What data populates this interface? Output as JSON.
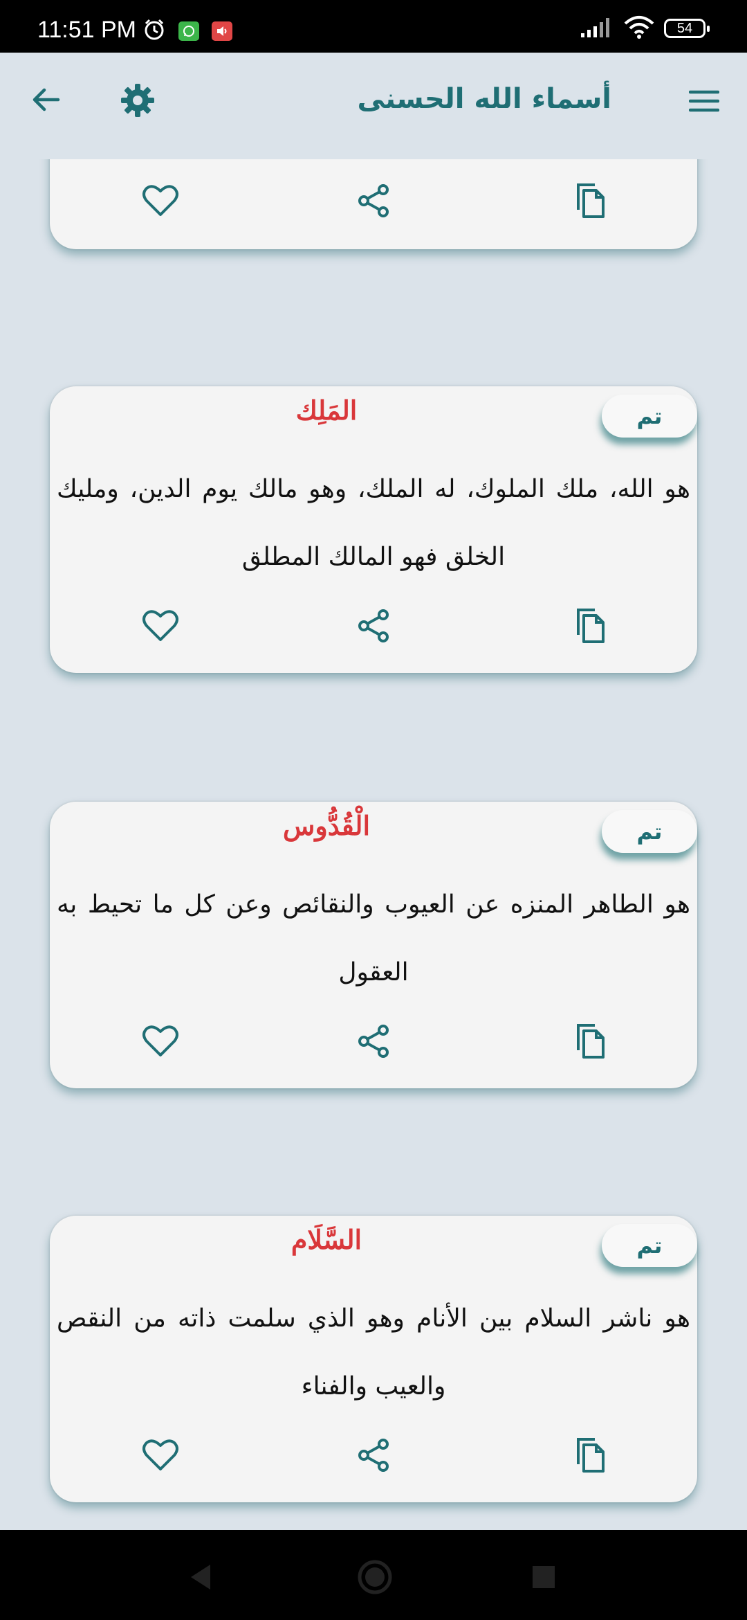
{
  "status_bar": {
    "time": "11:51 PM",
    "battery": "54"
  },
  "app_bar": {
    "title": "أسماء الله الحسنى"
  },
  "cards": [
    {
      "badge": "تم",
      "title": "المَلِك",
      "description": "هو الله، ملك الملوك، له الملك، وهو مالك يوم الدين، ومليك الخلق فهو المالك المطلق"
    },
    {
      "badge": "تم",
      "title": "الْقُدُّوس",
      "description": "هو الطاهر المنزه عن العيوب والنقائص وعن كل ما تحيط به العقول"
    },
    {
      "badge": "تم",
      "title": "السَّلَام",
      "description": "هو ناشر السلام بين الأنام وهو الذي سلمت ذاته من النقص والعيب والفناء"
    }
  ],
  "icons": {
    "favorite": "heart-outline",
    "share": "share",
    "copy": "copy",
    "settings": "gear",
    "back": "arrow-left",
    "menu": "hamburger"
  },
  "colors": {
    "accent": "#1f6e74",
    "title_red": "#d9373a",
    "background": "#dbe3ea",
    "card": "#f4f4f4"
  }
}
